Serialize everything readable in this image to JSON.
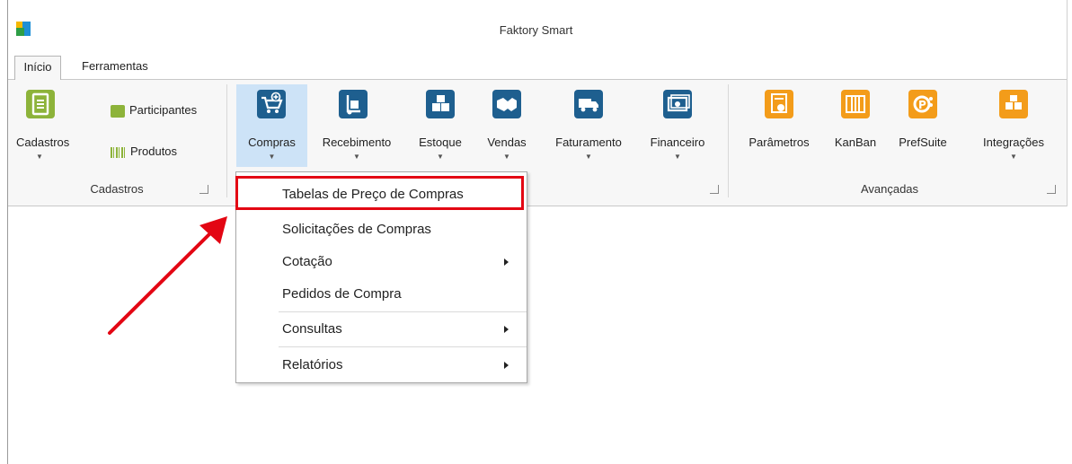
{
  "window": {
    "title": "Faktory Smart"
  },
  "tabs": [
    {
      "label": "Início",
      "active": true
    },
    {
      "label": "Ferramentas",
      "active": false
    }
  ],
  "ribbon": {
    "cadastros_group": {
      "label": "Cadastros",
      "big_button": "Cadastros",
      "small_buttons": [
        "Participantes",
        "Produtos"
      ]
    },
    "operations": [
      {
        "label": "Compras",
        "icon": "cart-icon",
        "selected": true
      },
      {
        "label": "Recebimento",
        "icon": "hand-truck-icon"
      },
      {
        "label": "Estoque",
        "icon": "boxes-icon"
      },
      {
        "label": "Vendas",
        "icon": "handshake-icon"
      },
      {
        "label": "Faturamento",
        "icon": "delivery-truck-icon"
      },
      {
        "label": "Financeiro",
        "icon": "money-icon"
      }
    ],
    "avancadas_group": {
      "label": "Avançadas",
      "buttons": [
        {
          "label": "Parâmetros",
          "icon": "parameters-icon"
        },
        {
          "label": "KanBan",
          "icon": "kanban-icon"
        },
        {
          "label": "PrefSuite",
          "icon": "prefsuite-icon"
        },
        {
          "label": "Integrações",
          "icon": "integrations-icon"
        }
      ]
    }
  },
  "compras_menu": {
    "items": [
      {
        "label": "Tabelas de Preço de Compras",
        "submenu": false,
        "highlighted": true
      },
      {
        "label": "Solicitações de Compras",
        "submenu": false
      },
      {
        "label": "Cotação",
        "submenu": true
      },
      {
        "label": "Pedidos de Compra",
        "submenu": false
      },
      {
        "label": "Consultas",
        "submenu": true
      },
      {
        "label": "Relatórios",
        "submenu": true
      }
    ]
  },
  "colors": {
    "green_icon": "#8db33a",
    "blue_icon": "#1e5f8f",
    "orange_icon": "#f39c1a",
    "selection": "#cde3f7",
    "highlight_box": "#e30613",
    "annotation_arrow": "#e30613"
  }
}
